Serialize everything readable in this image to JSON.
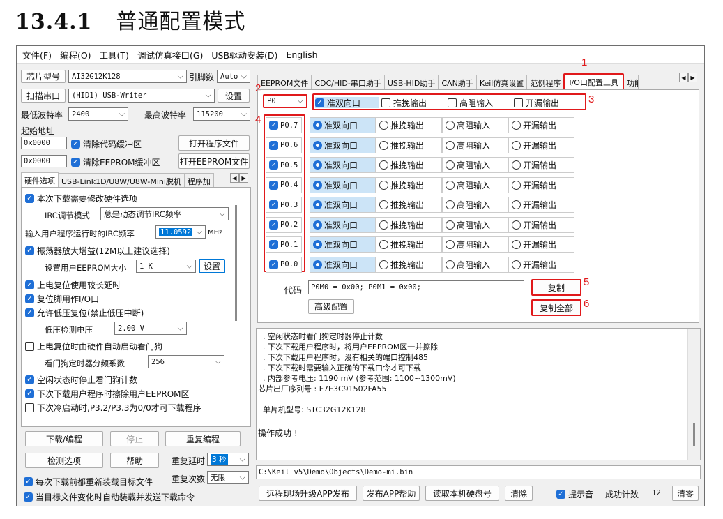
{
  "heading": {
    "number": "13.4.1",
    "title": "普通配置模式"
  },
  "menu": [
    "文件(F)",
    "编程(O)",
    "工具(T)",
    "调试仿真接口(G)",
    "USB驱动安装(D)",
    "English"
  ],
  "left": {
    "chip_label": "芯片型号",
    "chip_value": "AI32G12K128",
    "pins_label": "引脚数",
    "pins_value": "Auto",
    "scan_label": "扫描串口",
    "port_value": "(HID1) USB-Writer",
    "settings_label": "设置",
    "min_baud_label": "最低波特率",
    "min_baud_value": "2400",
    "max_baud_label": "最高波特率",
    "max_baud_value": "115200",
    "start_addr_label": "起始地址",
    "addr1": "0x0000",
    "clear_code_label": "清除代码缓冲区",
    "open_prog_label": "打开程序文件",
    "addr2": "0x0000",
    "clear_eeprom_label": "清除EEPROM缓冲区",
    "open_eeprom_label": "打开EEPROM文件",
    "tabs": [
      "硬件选项",
      "USB-Link1D/U8W/U8W-Mini脱机",
      "程序加"
    ],
    "opts": {
      "o1": "本次下载需要修改硬件选项",
      "irc_mode_label": "IRC调节模式",
      "irc_mode_value": "总是动态调节IRC频率",
      "irc_freq_label": "输入用户程序运行时的IRC频率",
      "irc_freq_value": "11.0592",
      "irc_freq_unit": "MHz",
      "o2": "振荡器放大增益(12M以上建议选择)",
      "eeprom_size_label": "设置用户EEPROM大小",
      "eeprom_size_value": "1   K",
      "eeprom_set_label": "设置",
      "o3": "上电复位使用较长延时",
      "o4": "复位脚用作I/O口",
      "o5": "允许低压复位(禁止低压中断)",
      "lv_label": "低压检测电压",
      "lv_value": "2.00 V",
      "o6": "上电复位时由硬件自动启动看门狗",
      "wdt_label": "看门狗定时器分频系数",
      "wdt_value": "256",
      "o7": "空闲状态时停止看门狗计数",
      "o8": "下次下载用户程序时擦除用户EEPROM区",
      "o9": "下次冷启动时,P3.2/P3.3为0/0才可下载程序"
    },
    "download_label": "下载/编程",
    "stop_label": "停止",
    "reprogram_label": "重复编程",
    "detect_label": "检测选项",
    "help_label": "帮助",
    "repeat_delay_label": "重复延时",
    "repeat_delay_value": "3 秒",
    "repeat_count_label": "重复次数",
    "repeat_count_value": "无限",
    "reload_label": "每次下载前都重新装载目标文件",
    "autoload_label": "当目标文件变化时自动装载并发送下载命令"
  },
  "right": {
    "tabs": [
      "EEPROM文件",
      "CDC/HID-串口助手",
      "USB-HID助手",
      "CAN助手",
      "Keil仿真设置",
      "范例程序",
      "I/O口配置工具",
      "功能"
    ],
    "port_select": "P0",
    "header_opts": [
      "准双向口",
      "推挽输出",
      "高阻输入",
      "开漏输出"
    ],
    "pins": [
      "P0.7",
      "P0.6",
      "P0.5",
      "P0.4",
      "P0.3",
      "P0.2",
      "P0.1",
      "P0.0"
    ],
    "code_label": "代码",
    "code_value": "P0M0 = 0x00; P0M1 = 0x00;",
    "copy_label": "复制",
    "advanced_label": "高级配置",
    "copy_all_label": "复制全部",
    "callouts": [
      "1",
      "2",
      "3",
      "4",
      "5",
      "6"
    ],
    "log_lines": [
      "  . 空闲状态时看门狗定时器停止计数",
      "  . 下次下载用户程序时，将用户EEPROM区一并擦除",
      "  . 下次下载用户程序时，没有相关的端口控制485",
      "  . 下次下载时需要输入正确的下载口令才可下载",
      "  . 内部参考电压: 1190 mV (参考范围: 1100~1300mV)",
      "芯片出厂序列号 : F7E3C91502FA55",
      "",
      "  单片机型号: STC32G12K128",
      "",
      "操作成功 !"
    ],
    "file_path": "C:\\Keil_v5\\Demo\\Objects\\Demo-mi.bin",
    "remote_label": "远程现场升级APP发布",
    "publish_help_label": "发布APP帮助",
    "read_disk_label": "读取本机硬盘号",
    "clear_label": "清除",
    "beep_label": "提示音",
    "success_count_label": "成功计数",
    "success_count_value": "12",
    "clear_count_label": "清零"
  },
  "colors": {
    "accent": "#1f6fd6",
    "callout": "#e0191b",
    "highlight": "#cce4f7"
  }
}
